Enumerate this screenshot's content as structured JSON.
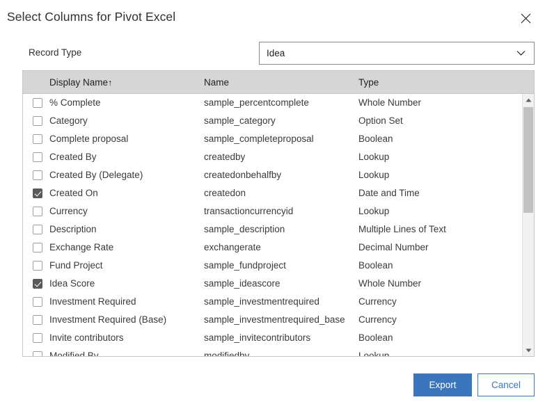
{
  "dialog": {
    "title": "Select Columns for Pivot Excel",
    "close_icon": "close-icon"
  },
  "record_type": {
    "label": "Record Type",
    "value": "Idea",
    "placeholder": "Idea",
    "chevron_icon": "chevron-down-icon"
  },
  "grid": {
    "columns": [
      {
        "key": "display_name",
        "label": "Display Name",
        "sorted": true,
        "sort_arrow": "↑"
      },
      {
        "key": "name",
        "label": "Name",
        "sorted": false,
        "sort_arrow": ""
      },
      {
        "key": "type",
        "label": "Type",
        "sorted": false,
        "sort_arrow": ""
      }
    ],
    "rows": [
      {
        "checked": false,
        "display_name": "% Complete",
        "name": "sample_percentcomplete",
        "type": "Whole Number"
      },
      {
        "checked": false,
        "display_name": "Category",
        "name": "sample_category",
        "type": "Option Set"
      },
      {
        "checked": false,
        "display_name": "Complete proposal",
        "name": "sample_completeproposal",
        "type": "Boolean"
      },
      {
        "checked": false,
        "display_name": "Created By",
        "name": "createdby",
        "type": "Lookup"
      },
      {
        "checked": false,
        "display_name": "Created By (Delegate)",
        "name": "createdonbehalfby",
        "type": "Lookup"
      },
      {
        "checked": true,
        "display_name": "Created On",
        "name": "createdon",
        "type": "Date and Time"
      },
      {
        "checked": false,
        "display_name": "Currency",
        "name": "transactioncurrencyid",
        "type": "Lookup"
      },
      {
        "checked": false,
        "display_name": "Description",
        "name": "sample_description",
        "type": "Multiple Lines of Text"
      },
      {
        "checked": false,
        "display_name": "Exchange Rate",
        "name": "exchangerate",
        "type": "Decimal Number"
      },
      {
        "checked": false,
        "display_name": "Fund Project",
        "name": "sample_fundproject",
        "type": "Boolean"
      },
      {
        "checked": true,
        "display_name": "Idea Score",
        "name": "sample_ideascore",
        "type": "Whole Number"
      },
      {
        "checked": false,
        "display_name": "Investment Required",
        "name": "sample_investmentrequired",
        "type": "Currency"
      },
      {
        "checked": false,
        "display_name": "Investment Required (Base)",
        "name": "sample_investmentrequired_base",
        "type": "Currency"
      },
      {
        "checked": false,
        "display_name": "Invite contributors",
        "name": "sample_invitecontributors",
        "type": "Boolean"
      },
      {
        "checked": false,
        "display_name": "Modified By",
        "name": "modifiedby",
        "type": "Lookup"
      }
    ],
    "scrollbar": {
      "up_icon": "scroll-up-arrow-icon",
      "down_icon": "scroll-down-arrow-icon"
    }
  },
  "footer": {
    "export_label": "Export",
    "cancel_label": "Cancel"
  },
  "colors": {
    "accent": "#3b76bc",
    "header_bg": "#d6d6d6",
    "border": "#c8c6c4",
    "checkbox_checked": "#5a5a5a"
  }
}
